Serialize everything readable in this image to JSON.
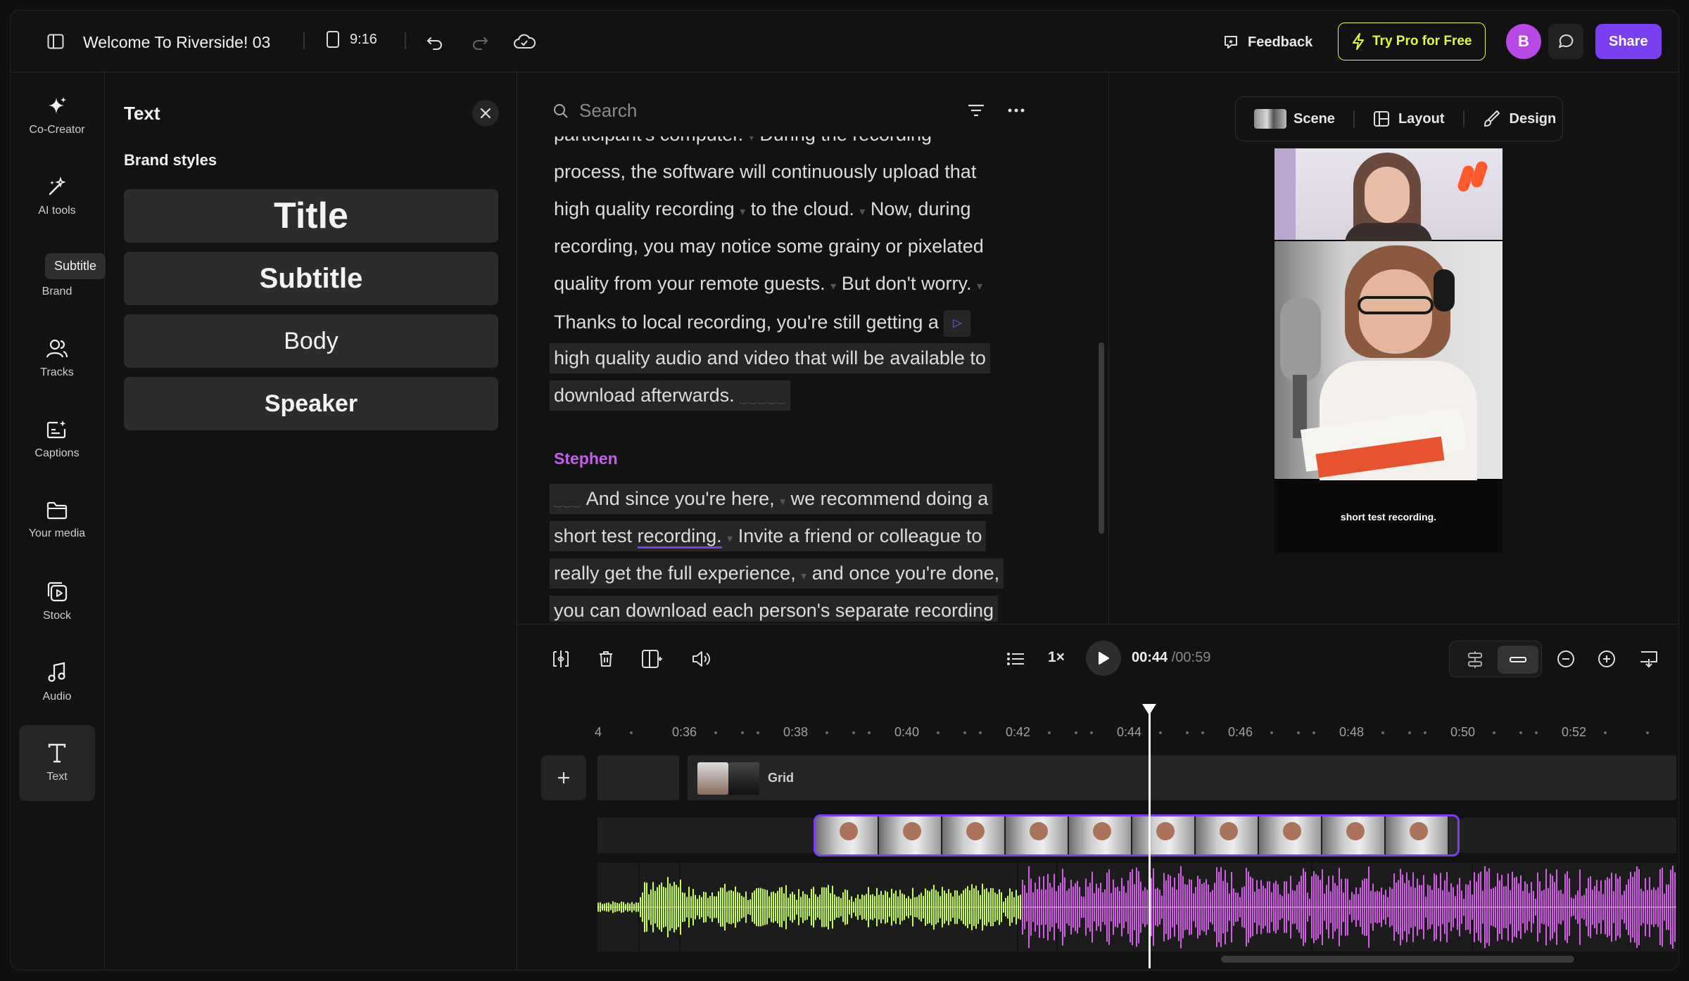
{
  "topbar": {
    "project_title": "Welcome To Riverside! 03",
    "aspect_ratio": "9:16",
    "feedback_label": "Feedback",
    "try_pro_label": "Try Pro for Free",
    "avatar_initial": "B",
    "share_label": "Share"
  },
  "rail": {
    "items": [
      {
        "label": "Co-Creator",
        "icon": "sparkle-icon"
      },
      {
        "label": "AI tools",
        "icon": "magic-wand-icon"
      },
      {
        "label": "Brand",
        "icon": "palette-icon"
      },
      {
        "label": "Tracks",
        "icon": "people-icon"
      },
      {
        "label": "Captions",
        "icon": "captions-icon"
      },
      {
        "label": "Your media",
        "icon": "folder-icon"
      },
      {
        "label": "Stock",
        "icon": "stock-media-icon"
      },
      {
        "label": "Audio",
        "icon": "music-note-icon"
      },
      {
        "label": "Text",
        "icon": "text-t-icon"
      }
    ],
    "tooltip": "Subtitle"
  },
  "text_panel": {
    "heading": "Text",
    "section_label": "Brand styles",
    "styles": [
      "Title",
      "Subtitle",
      "Body",
      "Speaker"
    ]
  },
  "transcript": {
    "search_placeholder": "Search",
    "lines": [
      "participant's computer.",
      "During the recording",
      "process, the software will continuously upload that",
      "high quality recording",
      "to the cloud.",
      "Now, during",
      "recording, you may notice some grainy or pixelated",
      "quality from your remote guests.",
      "But don't worry.",
      "Thanks to local recording, you're still getting a",
      "high quality audio and video that will be available to",
      "download afterwards."
    ],
    "speaker": "Stephen",
    "speaker_lines": [
      "And since you're here,",
      "we recommend doing a",
      "short test",
      "recording.",
      "Invite a friend or colleague to",
      "really get the full experience,",
      "and once you're done,",
      "you can download each person's separate recording"
    ]
  },
  "preview": {
    "scene_label": "Scene",
    "layout_label": "Layout",
    "design_label": "Design",
    "caption_text": "short test recording."
  },
  "playback": {
    "speed": "1×",
    "current_time": "00:44",
    "total_time": "/00:59"
  },
  "timeline": {
    "ticks": [
      "4",
      "0:36",
      "0:38",
      "0:40",
      "0:42",
      "0:44",
      "0:46",
      "0:48",
      "0:50",
      "0:52"
    ],
    "grid_label": "Grid"
  },
  "colors": {
    "accent": "#7b3ff2",
    "pro_lime": "#d9ff3a",
    "speaker_pink": "#c65df0",
    "wave_lime": "#c7ff4a",
    "wave_pink": "#d45de8"
  }
}
